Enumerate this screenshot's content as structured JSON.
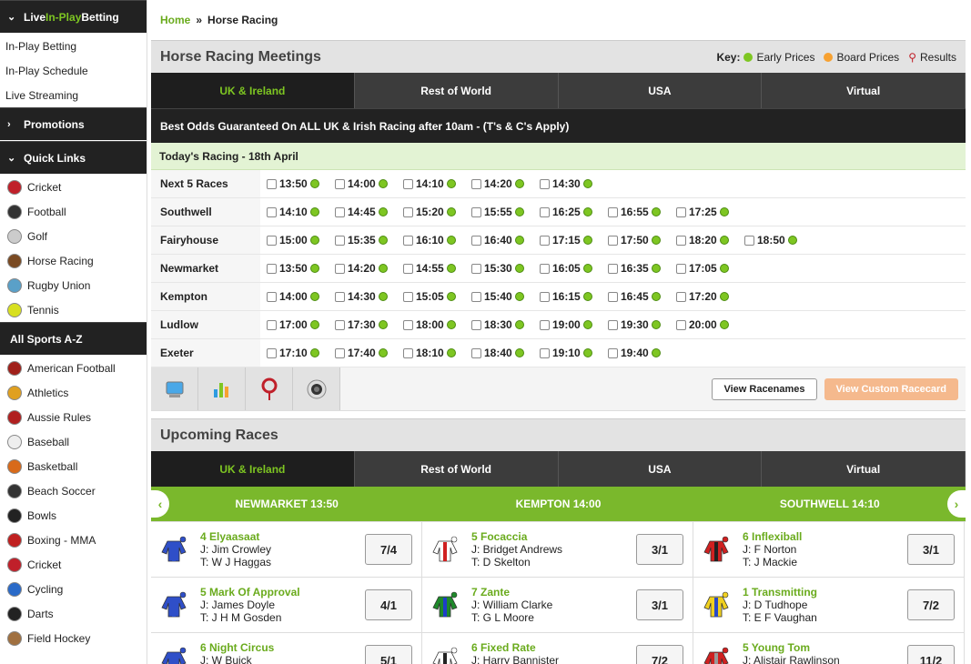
{
  "sidebar": {
    "live_label_prefix": "Live ",
    "live_label_green": "In-Play",
    "live_label_suffix": " Betting",
    "live_links": [
      "In-Play Betting",
      "In-Play Schedule",
      "Live Streaming"
    ],
    "promotions": "Promotions",
    "quick_links_title": "Quick Links",
    "quick_links": [
      "Cricket",
      "Football",
      "Golf",
      "Horse Racing",
      "Rugby Union",
      "Tennis"
    ],
    "az_title": "All Sports A-Z",
    "az": [
      "American Football",
      "Athletics",
      "Aussie Rules",
      "Baseball",
      "Basketball",
      "Beach Soccer",
      "Bowls",
      "Boxing - MMA",
      "Cricket",
      "Cycling",
      "Darts",
      "Field Hockey"
    ]
  },
  "breadcrumb": {
    "home": "Home",
    "sep": "»",
    "current": "Horse Racing"
  },
  "meetings": {
    "title": "Horse Racing Meetings",
    "key_label": "Key:",
    "key_early": "Early Prices",
    "key_board": "Board Prices",
    "key_results": "Results",
    "colors": {
      "early": "#7ec622",
      "board": "#f7a131",
      "results": "#c0202a"
    },
    "tabs": [
      "UK & Ireland",
      "Rest of World",
      "USA",
      "Virtual"
    ],
    "promo": "Best Odds Guaranteed On ALL UK & Irish Racing after 10am - (T's & C's Apply)",
    "today": "Today's Racing - 18th April",
    "rows": [
      {
        "name": "Next 5 Races",
        "times": [
          "13:50",
          "14:00",
          "14:10",
          "14:20",
          "14:30"
        ]
      },
      {
        "name": "Southwell",
        "times": [
          "14:10",
          "14:45",
          "15:20",
          "15:55",
          "16:25",
          "16:55",
          "17:25"
        ]
      },
      {
        "name": "Fairyhouse",
        "times": [
          "15:00",
          "15:35",
          "16:10",
          "16:40",
          "17:15",
          "17:50",
          "18:20",
          "18:50"
        ]
      },
      {
        "name": "Newmarket",
        "times": [
          "13:50",
          "14:20",
          "14:55",
          "15:30",
          "16:05",
          "16:35",
          "17:05"
        ]
      },
      {
        "name": "Kempton",
        "times": [
          "14:00",
          "14:30",
          "15:05",
          "15:40",
          "16:15",
          "16:45",
          "17:20"
        ]
      },
      {
        "name": "Ludlow",
        "times": [
          "17:00",
          "17:30",
          "18:00",
          "18:30",
          "19:00",
          "19:30",
          "20:00"
        ]
      },
      {
        "name": "Exeter",
        "times": [
          "17:10",
          "17:40",
          "18:10",
          "18:40",
          "19:10",
          "19:40"
        ]
      }
    ],
    "btn_view": "View Racenames",
    "btn_custom": "View Custom Racecard"
  },
  "upcoming": {
    "title": "Upcoming Races",
    "tabs": [
      "UK & Ireland",
      "Rest of World",
      "USA",
      "Virtual"
    ],
    "races": [
      "NEWMARKET 13:50",
      "KEMPTON 14:00",
      "SOUTHWELL 14:10"
    ],
    "columns": [
      [
        {
          "name": "4 Elyaasaat",
          "jockey": "J: Jim Crowley",
          "trainer": "T: W J Haggas",
          "odds": "7/4",
          "silk": "blue"
        },
        {
          "name": "5 Mark Of Approval",
          "jockey": "J: James Doyle",
          "trainer": "T: J H M Gosden",
          "odds": "4/1",
          "silk": "blue"
        },
        {
          "name": "6 Night Circus",
          "jockey": "J: W Buick",
          "trainer": "T: C Appleby",
          "odds": "5/1",
          "silk": "blue"
        }
      ],
      [
        {
          "name": "5 Focaccia",
          "jockey": "J: Bridget Andrews",
          "trainer": "T: D Skelton",
          "odds": "3/1",
          "silk": "whitered"
        },
        {
          "name": "7 Zante",
          "jockey": "J: William Clarke",
          "trainer": "T: G L Moore",
          "odds": "3/1",
          "silk": "green"
        },
        {
          "name": "6 Fixed Rate",
          "jockey": "J: Harry Bannister",
          "trainer": "T: C J Mann",
          "odds": "7/2",
          "silk": "stripes"
        }
      ],
      [
        {
          "name": "6 Inflexiball",
          "jockey": "J: F Norton",
          "trainer": "T: J Mackie",
          "odds": "3/1",
          "silk": "redblack"
        },
        {
          "name": "1 Transmitting",
          "jockey": "J: D Tudhope",
          "trainer": "T: E F Vaughan",
          "odds": "7/2",
          "silk": "yellowblue"
        },
        {
          "name": "5 Young Tom",
          "jockey": "J: Alistair Rawlinson",
          "trainer": "T: M Appleby",
          "odds": "11/2",
          "silk": "redgrey"
        }
      ]
    ]
  }
}
